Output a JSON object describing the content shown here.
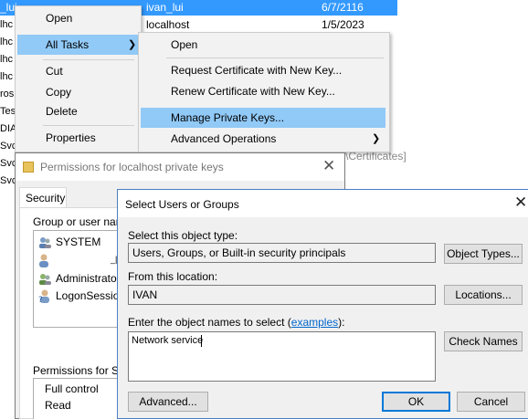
{
  "background_list": {
    "rows": [
      {
        "left": "_lui",
        "name": "ivan_lui",
        "date": "6/7/2116",
        "selected": true
      },
      {
        "left": "lhc",
        "name": "localhost",
        "date": "1/5/2023"
      },
      {
        "left": "lhc"
      },
      {
        "left": "lhc"
      },
      {
        "left": "lhc"
      },
      {
        "left": "ros"
      },
      {
        "left": "Tes"
      },
      {
        "left": "DIA"
      },
      {
        "left": "Svc"
      },
      {
        "left": "Svc"
      },
      {
        "left": "Svc"
      }
    ],
    "path_fragment": "\\Certificates]"
  },
  "context_menu": {
    "items": {
      "open": "Open",
      "all_tasks": "All Tasks",
      "cut": "Cut",
      "copy": "Copy",
      "delete": "Delete",
      "properties": "Properties"
    }
  },
  "submenu": {
    "items": {
      "open": "Open",
      "request_cert": "Request Certificate with New Key...",
      "renew_cert": "Renew Certificate with New Key...",
      "manage_keys": "Manage Private Keys...",
      "advanced_ops": "Advanced Operations"
    }
  },
  "permissions_dialog": {
    "title": "Permissions for localhost private keys",
    "tab": "Security",
    "group_label": "Group or user name",
    "users": [
      {
        "name": "SYSTEM",
        "icon": "users-icon"
      },
      {
        "name": "",
        "icon": "user-icon"
      },
      {
        "name": "Administrators",
        "icon": "users-icon"
      },
      {
        "name": "LogonSession",
        "icon": "user-question-icon"
      }
    ],
    "permissions_label": "Permissions for SYS",
    "permissions": [
      "Full control",
      "Read"
    ]
  },
  "select_dialog": {
    "title": "Select Users or Groups",
    "object_type_label": "Select this object type:",
    "object_type_value": "Users, Groups, or Built-in security principals",
    "object_types_button": "Object Types...",
    "location_label": "From this location:",
    "location_value": "IVAN",
    "locations_button": "Locations...",
    "names_label_prefix": "Enter the object names to select (",
    "names_label_link": "examples",
    "names_label_suffix": "):",
    "names_value": "Network service",
    "check_names_button": "Check Names",
    "advanced_button": "Advanced...",
    "ok_button": "OK",
    "cancel_button": "Cancel"
  },
  "colors": {
    "selection": "#3399ff",
    "menu_highlight": "#91c9f7",
    "default_button_border": "#0078d7",
    "link": "#0066cc"
  }
}
